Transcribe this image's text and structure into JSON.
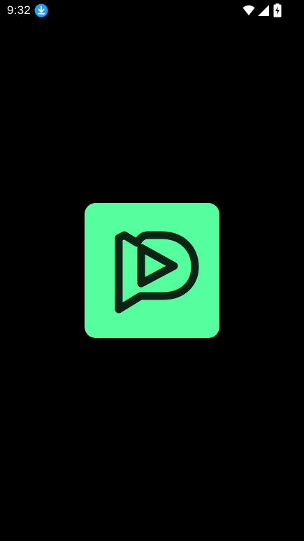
{
  "status_bar": {
    "time": "9:32",
    "notification_icons": [
      "download-icon"
    ],
    "system_icons": [
      "wifi-icon",
      "cell-signal-icon",
      "battery-charging-icon"
    ],
    "download_badge_color": "#1da1f2"
  },
  "splash": {
    "logo_icon": "app-logo-icon",
    "logo_background": "#55ff9e",
    "logo_foreground": "#0b2416",
    "screen_background": "#000000"
  }
}
